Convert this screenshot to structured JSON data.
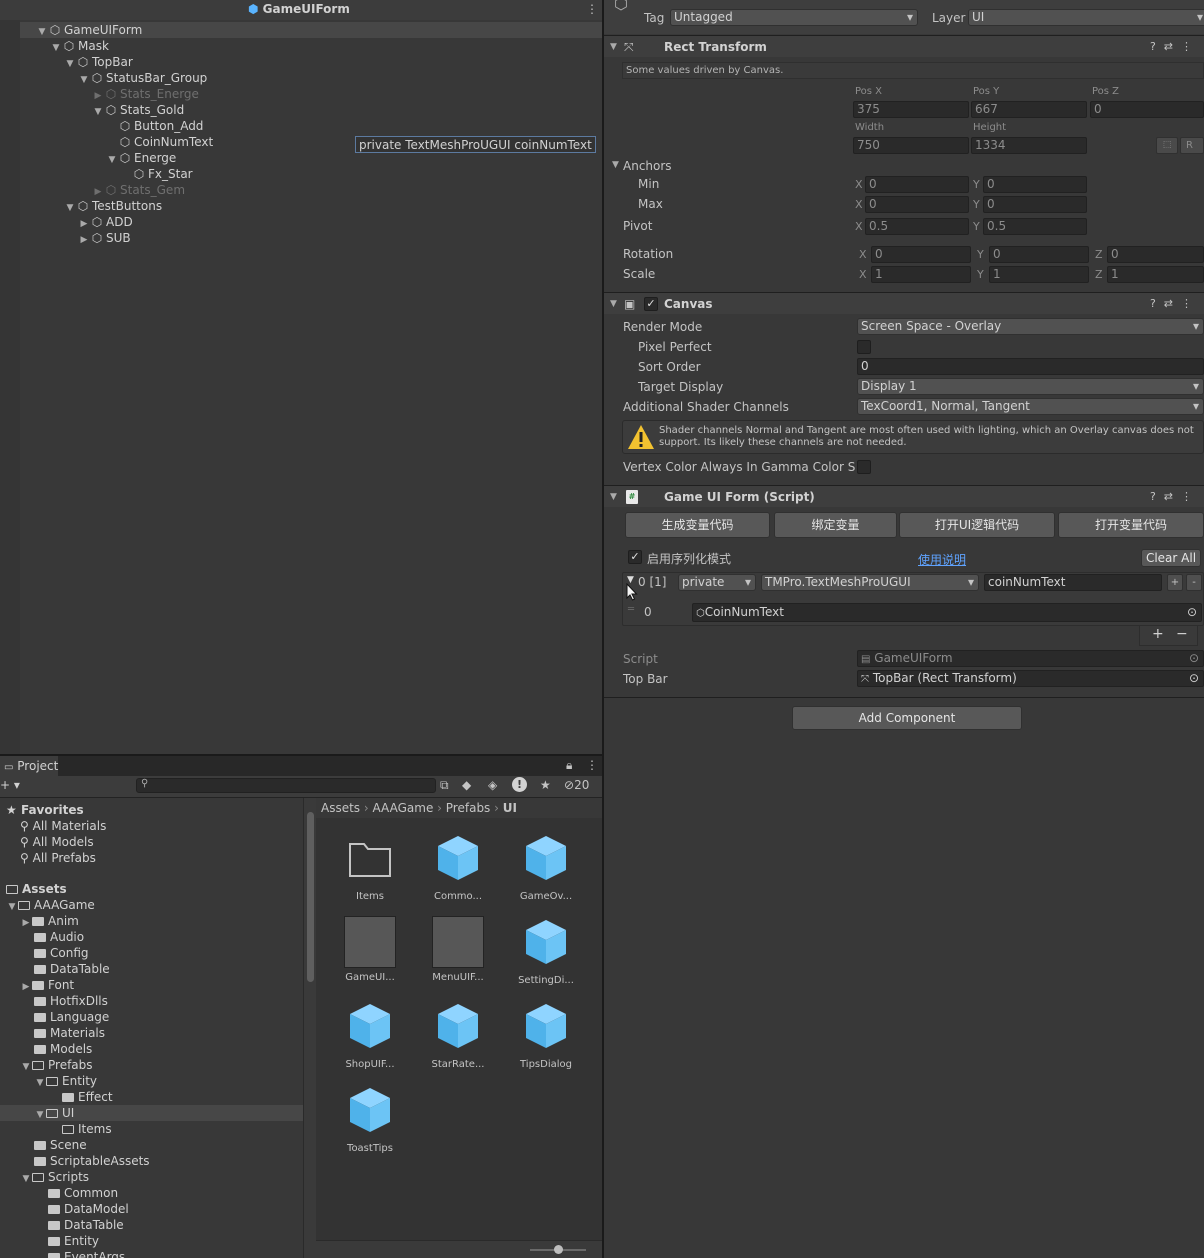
{
  "hierarchy": {
    "title": "GameUIForm",
    "rows": [
      {
        "label": "GameUIForm",
        "expanded": true
      },
      {
        "label": "Mask",
        "expanded": true
      },
      {
        "label": "TopBar",
        "expanded": true
      },
      {
        "label": "StatusBar_Group",
        "expanded": true
      },
      {
        "label": "Stats_Energe",
        "expanded": false
      },
      {
        "label": "Stats_Gold",
        "expanded": true
      },
      {
        "label": "Button_Add",
        "expanded": null
      },
      {
        "label": "CoinNumText",
        "expanded": null
      },
      {
        "label": "Energe",
        "expanded": true
      },
      {
        "label": "Fx_Star",
        "expanded": null
      },
      {
        "label": "Stats_Gem",
        "expanded": false
      },
      {
        "label": "TestButtons",
        "expanded": true
      },
      {
        "label": "ADD",
        "expanded": false
      },
      {
        "label": "SUB",
        "expanded": false
      }
    ],
    "tooltip": "private TextMeshProUGUI coinNumText"
  },
  "project": {
    "tab": "Project",
    "hidden_count": "20",
    "favorites_title": "Favorites",
    "favorites": [
      "All Materials",
      "All Models",
      "All Prefabs"
    ],
    "assets_title": "Assets",
    "tree": [
      "AAAGame",
      "Anim",
      "Audio",
      "Config",
      "DataTable",
      "Font",
      "HotfixDlls",
      "Language",
      "Materials",
      "Models",
      "Prefabs",
      "Entity",
      "Effect",
      "UI",
      "Items",
      "Scene",
      "ScriptableAssets",
      "Scripts",
      "Common",
      "DataModel",
      "DataTable",
      "Entity",
      "EventArgs"
    ],
    "breadcrumb": [
      "Assets",
      "AAAGame",
      "Prefabs",
      "UI"
    ],
    "assets": [
      "Items",
      "Commo...",
      "GameOv...",
      "GameUI...",
      "MenuUIF...",
      "SettingDi...",
      "ShopUIF...",
      "StarRate...",
      "TipsDialog",
      "ToastTips"
    ]
  },
  "inspector": {
    "tag_label": "Tag",
    "tag_value": "Untagged",
    "layer_label": "Layer",
    "layer_value": "UI",
    "rect": {
      "title": "Rect Transform",
      "note": "Some values driven by Canvas.",
      "posx_label": "Pos X",
      "posy_label": "Pos Y",
      "posz_label": "Pos Z",
      "posx": "375",
      "posy": "667",
      "posz": "0",
      "width_label": "Width",
      "height_label": "Height",
      "width": "750",
      "height": "1334",
      "r_label": "R",
      "anchors_label": "Anchors",
      "min_label": "Min",
      "max_label": "Max",
      "min_x": "0",
      "min_y": "0",
      "max_x": "0",
      "max_y": "0",
      "pivot_label": "Pivot",
      "pivot_x": "0.5",
      "pivot_y": "0.5",
      "rotation_label": "Rotation",
      "rot_x": "0",
      "rot_y": "0",
      "rot_z": "0",
      "scale_label": "Scale",
      "scale_x": "1",
      "scale_y": "1",
      "scale_z": "1",
      "x": "X",
      "y": "Y",
      "z": "Z"
    },
    "canvas": {
      "title": "Canvas",
      "render_mode_label": "Render Mode",
      "render_mode": "Screen Space - Overlay",
      "pixel_perfect_label": "Pixel Perfect",
      "sort_order_label": "Sort Order",
      "sort_order": "0",
      "target_display_label": "Target Display",
      "target_display": "Display 1",
      "shader_channels_label": "Additional Shader Channels",
      "shader_channels": "TexCoord1, Normal, Tangent",
      "warning": "Shader channels Normal and Tangent are most often used with lighting, which an Overlay canvas does not support. Its likely these channels are not needed.",
      "vertex_label": "Vertex Color Always In Gamma Color Spac"
    },
    "script": {
      "title": "Game UI Form (Script)",
      "buttons": [
        "生成变量代码",
        "绑定变量",
        "打开UI逻辑代码",
        "打开变量代码"
      ],
      "serialize_label": "启用序列化模式",
      "help_link": "使用说明",
      "clear_all": "Clear All",
      "item_index": "0 [1]",
      "access": "private",
      "type": "TMPro.TextMeshProUGUI",
      "var_name": "coinNumText",
      "element_index": "0",
      "element_value": "CoinNumText",
      "script_label": "Script",
      "script_value": "GameUIForm",
      "topbar_label": "Top Bar",
      "topbar_value": "TopBar (Rect Transform)"
    },
    "add_component": "Add Component"
  }
}
